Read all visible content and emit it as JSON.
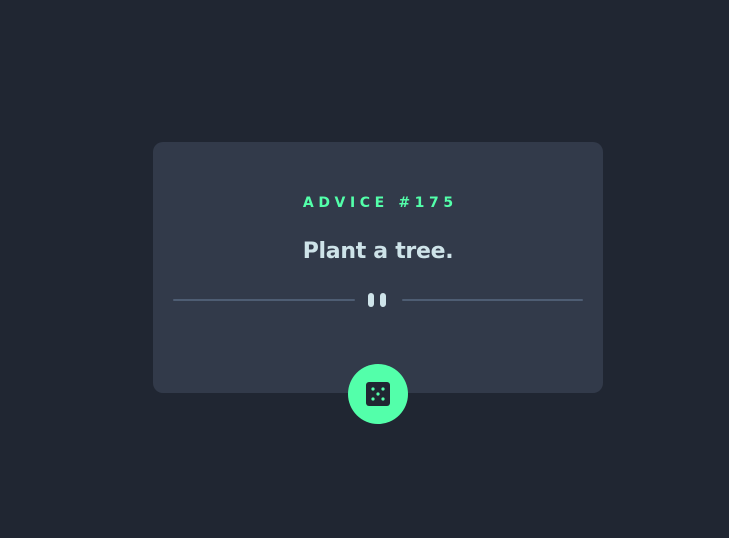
{
  "card": {
    "advice_label": "ADVICE #175",
    "advice_text": "Plant a tree."
  },
  "icons": {
    "divider": "pause-icon",
    "button": "dice-icon"
  },
  "colors": {
    "background": "#202632",
    "card": "#323A4A",
    "accent": "#53FFAA",
    "text": "#CEE3E9",
    "divider": "#4E5D73"
  }
}
